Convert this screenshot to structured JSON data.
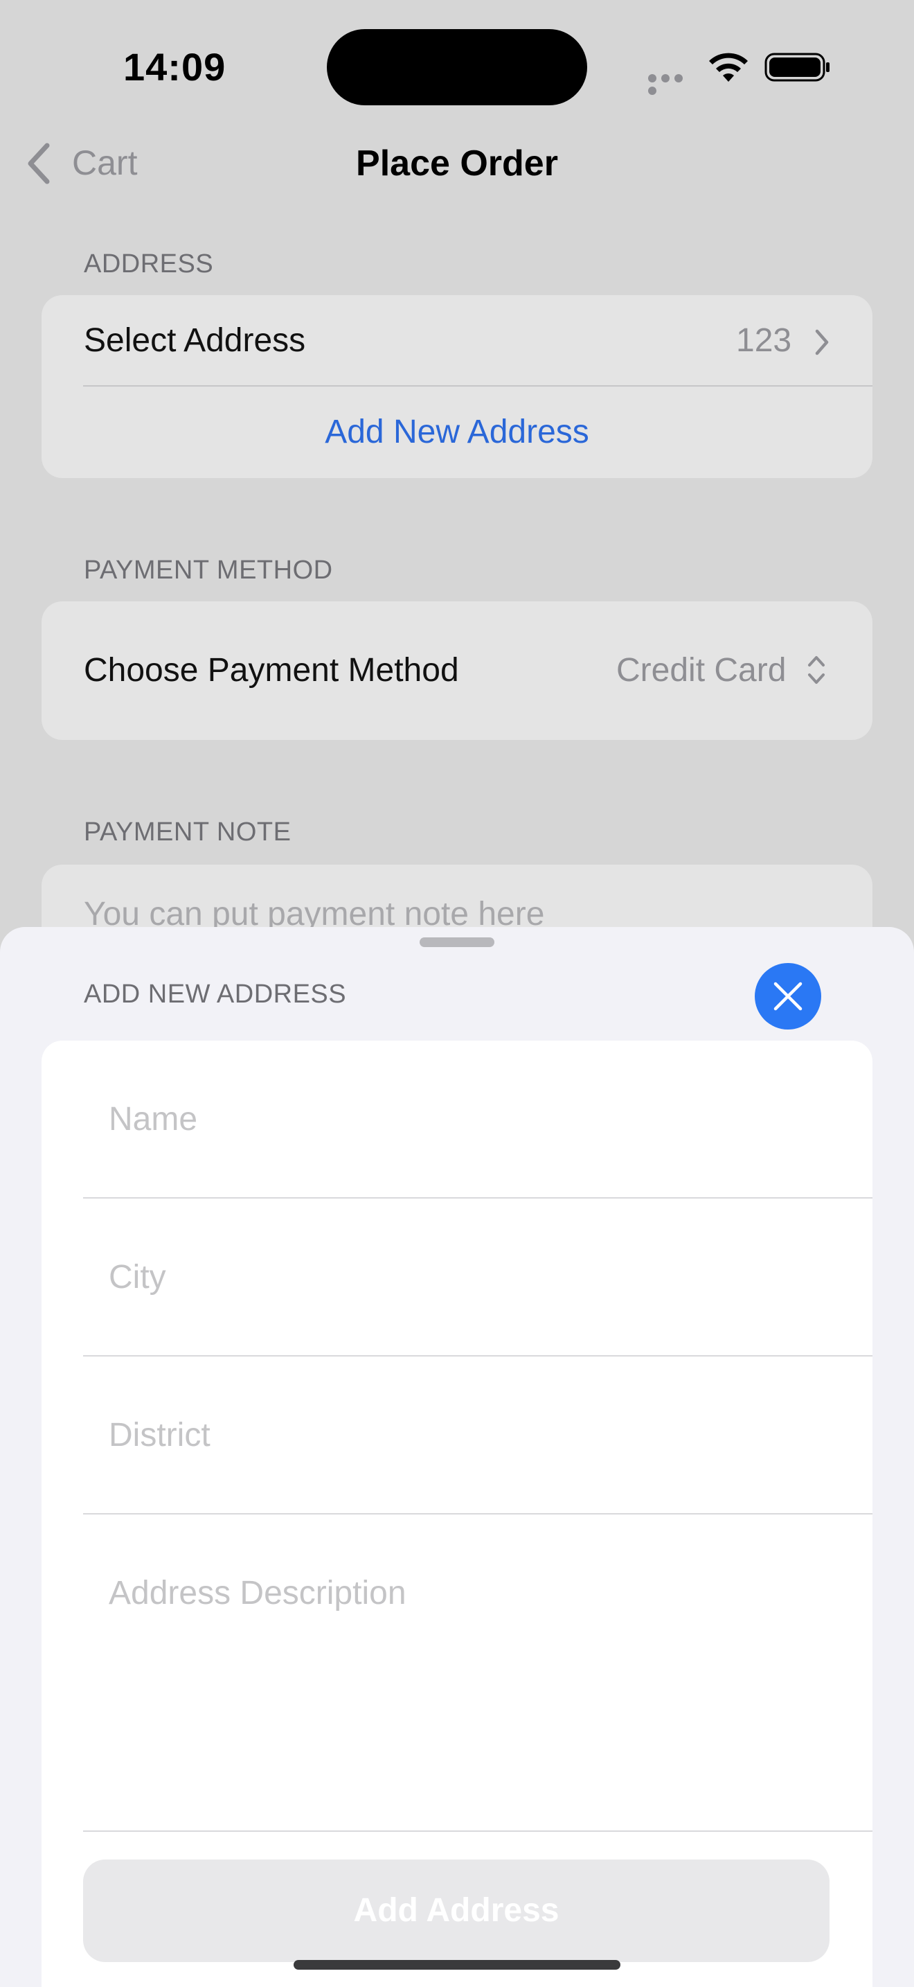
{
  "status_bar": {
    "time": "14:09",
    "icons": [
      "signal-dots-icon",
      "wifi-icon",
      "battery-icon"
    ]
  },
  "nav": {
    "back_label": "Cart",
    "title": "Place Order"
  },
  "address_section": {
    "header": "ADDRESS",
    "select_label": "Select Address",
    "select_value": "123",
    "add_new_link": "Add New Address"
  },
  "payment_section": {
    "header": "PAYMENT METHOD",
    "label": "Choose Payment Method",
    "value": "Credit Card"
  },
  "payment_note_section": {
    "header": "PAYMENT NOTE",
    "placeholder": "You can put payment note here"
  },
  "sheet": {
    "title": "ADD NEW ADDRESS",
    "fields": {
      "name_placeholder": "Name",
      "city_placeholder": "City",
      "district_placeholder": "District",
      "description_placeholder": "Address Description"
    },
    "submit_label": "Add Address"
  },
  "colors": {
    "accent": "#2a78f4",
    "link": "#2a67d8",
    "dim_background": "#d6d6d6",
    "sheet_background": "#f2f2f7"
  }
}
